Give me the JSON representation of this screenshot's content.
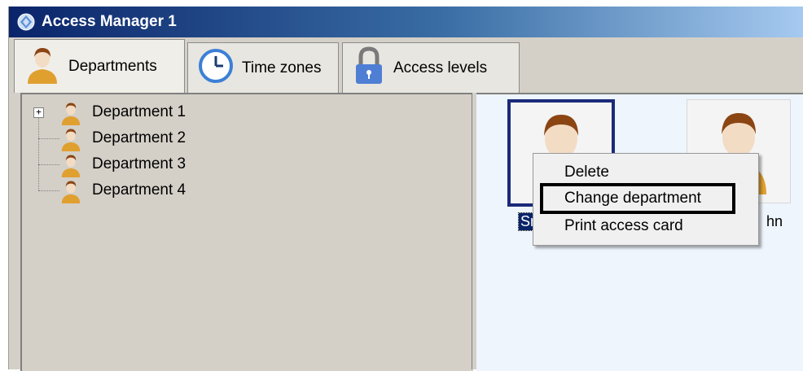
{
  "window": {
    "title": "Access Manager 1",
    "app_icon": "access-manager-icon"
  },
  "tabs": [
    {
      "label": "Departments",
      "icon": "person-icon",
      "active": true
    },
    {
      "label": "Time zones",
      "icon": "clock-icon",
      "active": false
    },
    {
      "label": "Access levels",
      "icon": "padlock-icon",
      "active": false
    }
  ],
  "tree": {
    "items": [
      {
        "label": "Department 1",
        "expandable": true,
        "expander": "+"
      },
      {
        "label": "Department 2",
        "expandable": false
      },
      {
        "label": "Department 3",
        "expandable": false
      },
      {
        "label": "Department 4",
        "expandable": false
      }
    ]
  },
  "employees": [
    {
      "caption_visible": "Sm",
      "selected": true
    },
    {
      "caption_visible": "hn",
      "selected": false
    }
  ],
  "context_menu": {
    "items": [
      {
        "label": "Delete"
      },
      {
        "label": "Change department",
        "highlighted": true
      },
      {
        "label": "Print access card"
      }
    ]
  },
  "colors": {
    "title_bar_start": "#0a246a",
    "selection": "#0a246a",
    "person_skin": "#f3dcc4",
    "person_hair": "#8b4513",
    "person_shirt": "#e0a030"
  }
}
